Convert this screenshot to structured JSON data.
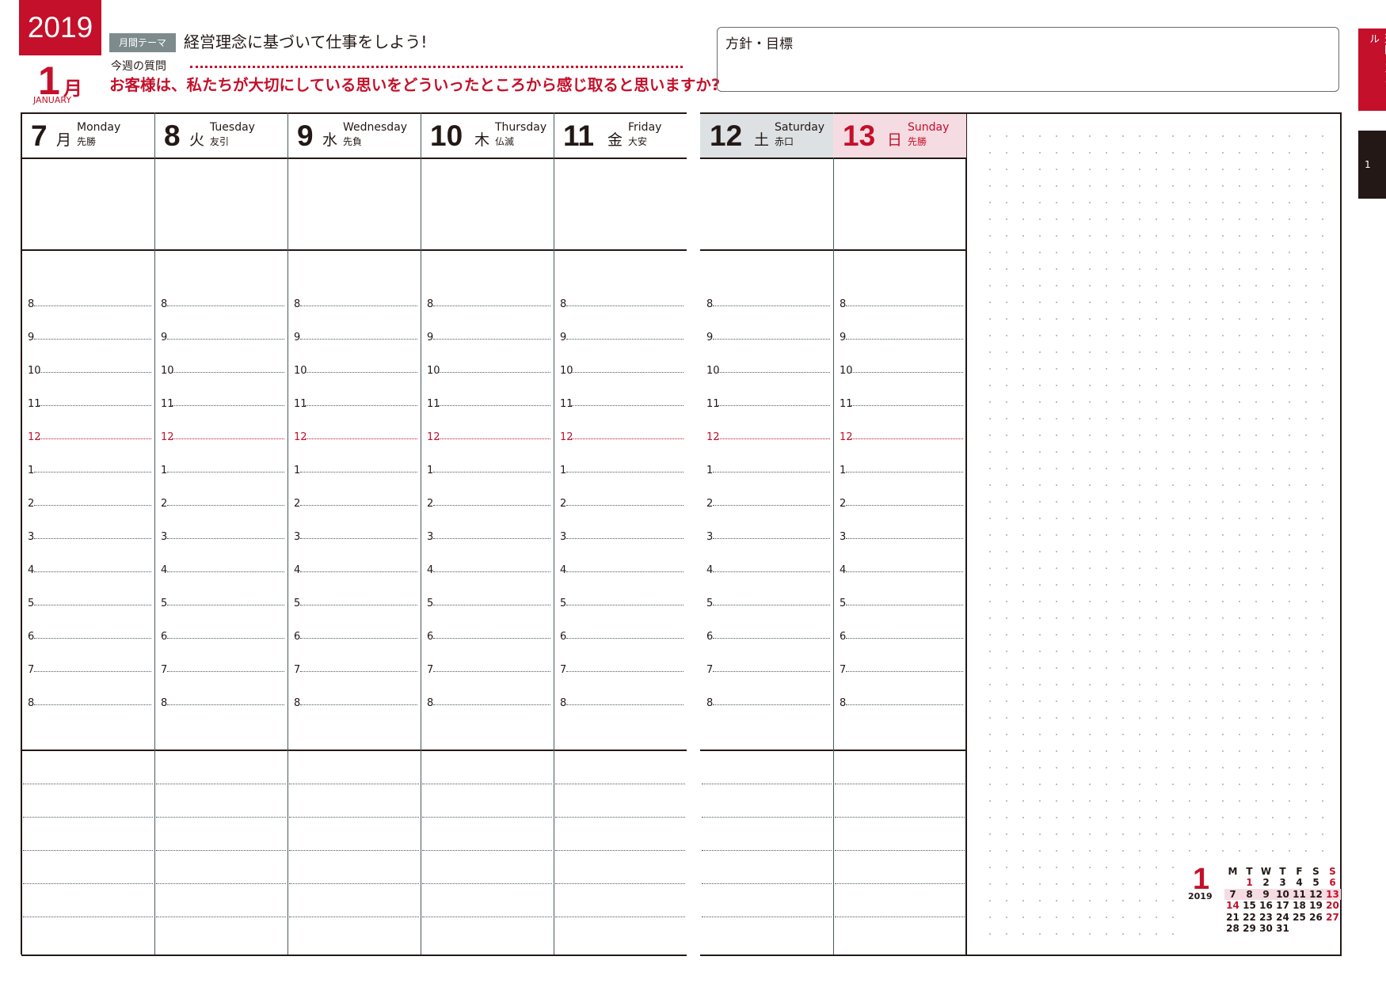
{
  "header": {
    "year": "2019",
    "month_number": "1",
    "month_kanji": "月",
    "month_english": "JANUARY",
    "theme_label": "月間テーマ",
    "theme_text": "経営理念に基づいて仕事をしよう!",
    "question_label": "今週の質問",
    "question_text": "お客様は、私たちが大切にしている思いをどういったところから感じ取ると思いますか?",
    "goals_label": "方針・目標"
  },
  "side_tabs": {
    "schedule": "週間スケジュール",
    "page_tab": "1"
  },
  "days": [
    {
      "date": "7",
      "kanji": "月",
      "english": "Monday",
      "rokuyo": "先勝",
      "type": "weekday"
    },
    {
      "date": "8",
      "kanji": "火",
      "english": "Tuesday",
      "rokuyo": "友引",
      "type": "weekday"
    },
    {
      "date": "9",
      "kanji": "水",
      "english": "Wednesday",
      "rokuyo": "先負",
      "type": "weekday"
    },
    {
      "date": "10",
      "kanji": "木",
      "english": "Thursday",
      "rokuyo": "仏滅",
      "type": "weekday"
    },
    {
      "date": "11",
      "kanji": "金",
      "english": "Friday",
      "rokuyo": "大安",
      "type": "weekday"
    },
    {
      "date": "12",
      "kanji": "土",
      "english": "Saturday",
      "rokuyo": "赤口",
      "type": "saturday"
    },
    {
      "date": "13",
      "kanji": "日",
      "english": "Sunday",
      "rokuyo": "先勝",
      "type": "sunday"
    }
  ],
  "hours": [
    "8",
    "9",
    "10",
    "11",
    "12",
    "1",
    "2",
    "3",
    "4",
    "5",
    "6",
    "7",
    "8"
  ],
  "mini_calendar": {
    "month": "1",
    "year": "2019",
    "weekday_headers": [
      "M",
      "T",
      "W",
      "T",
      "F",
      "S",
      "S"
    ],
    "weeks": [
      [
        "",
        "1",
        "2",
        "3",
        "4",
        "5",
        "6"
      ],
      [
        "7",
        "8",
        "9",
        "10",
        "11",
        "12",
        "13"
      ],
      [
        "14",
        "15",
        "16",
        "17",
        "18",
        "19",
        "20"
      ],
      [
        "21",
        "22",
        "23",
        "24",
        "25",
        "26",
        "27"
      ],
      [
        "28",
        "29",
        "30",
        "31",
        "",
        "",
        ""
      ]
    ],
    "holidays": [
      "1",
      "14"
    ],
    "highlighted_week": 2
  },
  "colors": {
    "accent_red": "#c4102a",
    "saturday_bg": "#dde1e3",
    "sunday_bg": "#f5dce3",
    "line_dark": "#231815"
  }
}
